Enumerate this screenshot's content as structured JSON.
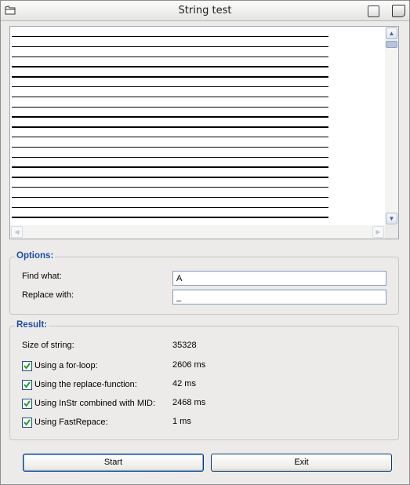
{
  "window": {
    "title": "String test"
  },
  "listbox": {
    "line_count": 19
  },
  "options": {
    "legend": "Options:",
    "find_label": "Find what:",
    "find_value": "A",
    "replace_label": "Replace with:",
    "replace_value": "_"
  },
  "result": {
    "legend": "Result:",
    "size_label": "Size of string:",
    "size_value": "35328",
    "rows": [
      {
        "label": "Using a for-loop:",
        "value": "2606 ms",
        "checked": true
      },
      {
        "label": "Using the replace-function:",
        "value": "42 ms",
        "checked": true
      },
      {
        "label": "Using InStr combined with MID:",
        "value": "2468 ms",
        "checked": true
      },
      {
        "label": "Using FastRepace:",
        "value": "1 ms",
        "checked": true
      }
    ]
  },
  "buttons": {
    "start": "Start",
    "exit": "Exit"
  },
  "colors": {
    "legend": "#1F4DA1",
    "button_border": "#003C74"
  }
}
